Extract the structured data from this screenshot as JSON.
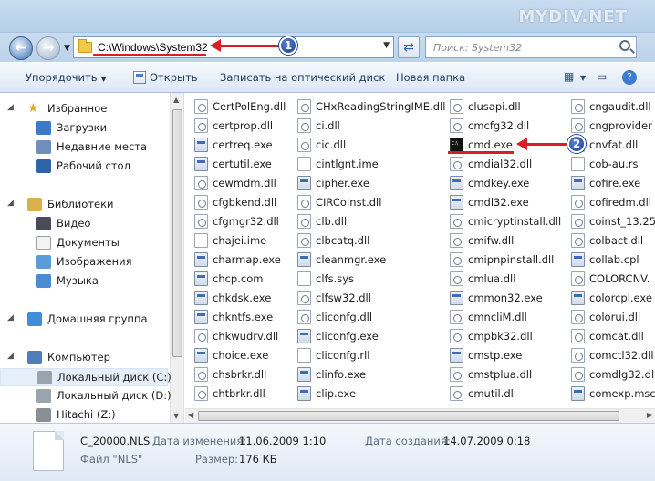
{
  "watermark": "MYDIV.NET",
  "address": {
    "path": "C:\\Windows\\System32"
  },
  "search": {
    "placeholder": "Поиск: System32"
  },
  "toolbar": {
    "organize": "Упорядочить",
    "open": "Открыть",
    "burn": "Записать на оптический диск",
    "new_folder": "Новая папка"
  },
  "nav": {
    "items": [
      {
        "label": "Избранное",
        "icon": "star-icon"
      },
      {
        "label": "Загрузки",
        "icon": "downloads-icon"
      },
      {
        "label": "Недавние места",
        "icon": "recent-places-icon"
      },
      {
        "label": "Рабочий стол",
        "icon": "desktop-icon"
      },
      {
        "label": "Библиотеки",
        "icon": "libraries-icon"
      },
      {
        "label": "Видео",
        "icon": "video-icon"
      },
      {
        "label": "Документы",
        "icon": "documents-icon"
      },
      {
        "label": "Изображения",
        "icon": "pictures-icon"
      },
      {
        "label": "Музыка",
        "icon": "music-icon"
      },
      {
        "label": "Домашняя группа",
        "icon": "homegroup-icon"
      },
      {
        "label": "Компьютер",
        "icon": "computer-icon"
      },
      {
        "label": "Локальный диск (C:)",
        "icon": "local-disk-icon"
      },
      {
        "label": "Локальный диск (D:)",
        "icon": "local-disk-icon"
      },
      {
        "label": "Hitachi (Z:)",
        "icon": "usb-drive-icon"
      }
    ]
  },
  "files": {
    "col1": [
      "CertPolEng.dll",
      "certprop.dll",
      "certreq.exe",
      "certutil.exe",
      "cewmdm.dll",
      "cfgbkend.dll",
      "cfgmgr32.dll",
      "chajei.ime",
      "charmap.exe",
      "chcp.com",
      "chkdsk.exe",
      "chkntfs.exe",
      "chkwudrv.dll",
      "choice.exe",
      "chsbrkr.dll",
      "chtbrkr.dll"
    ],
    "col2": [
      "CHxReadingStringIME.dll",
      "ci.dll",
      "cic.dll",
      "cintlgnt.ime",
      "cipher.exe",
      "CIRCoInst.dll",
      "clb.dll",
      "clbcatq.dll",
      "cleanmgr.exe",
      "clfs.sys",
      "clfsw32.dll",
      "cliconfg.dll",
      "cliconfg.exe",
      "cliconfg.rll",
      "clinfo.exe",
      "clip.exe"
    ],
    "col3": [
      "clusapi.dll",
      "cmcfg32.dll",
      "cmd.exe",
      "cmdial32.dll",
      "cmdkey.exe",
      "cmdl32.exe",
      "cmicryptinstall.dll",
      "cmifw.dll",
      "cmipnpinstall.dll",
      "cmlua.dll",
      "cmmon32.exe",
      "cmncliM.dll",
      "cmpbk32.dll",
      "cmstp.exe",
      "cmstplua.dll",
      "cmutil.dll"
    ],
    "col4": [
      "cngaudit.dll",
      "cngprovider",
      "cnvfat.dll",
      "cob-au.rs",
      "cofire.exe",
      "cofiredm.dll",
      "coinst_13.25",
      "colbact.dll",
      "collab.cpl",
      "COLORCNV.",
      "colorcpl.exe",
      "colorui.dll",
      "comcat.dll",
      "comctl32.dll",
      "comdlg32.dll",
      "comexp.msc"
    ]
  },
  "details": {
    "filename": "C_20000.NLS",
    "type_label": "Файл \"NLS\"",
    "modified_key": "Дата изменения:",
    "modified_val": "11.06.2009 1:10",
    "size_key": "Размер:",
    "size_val": "176 КБ",
    "created_key": "Дата создания:",
    "created_val": "14.07.2009 0:18"
  },
  "annotations": {
    "badge1": "1",
    "badge2": "2"
  },
  "colors": {
    "annotation": "#d91f26",
    "badge": "#1f4aa3",
    "toolbar_text": "#1e395b"
  }
}
